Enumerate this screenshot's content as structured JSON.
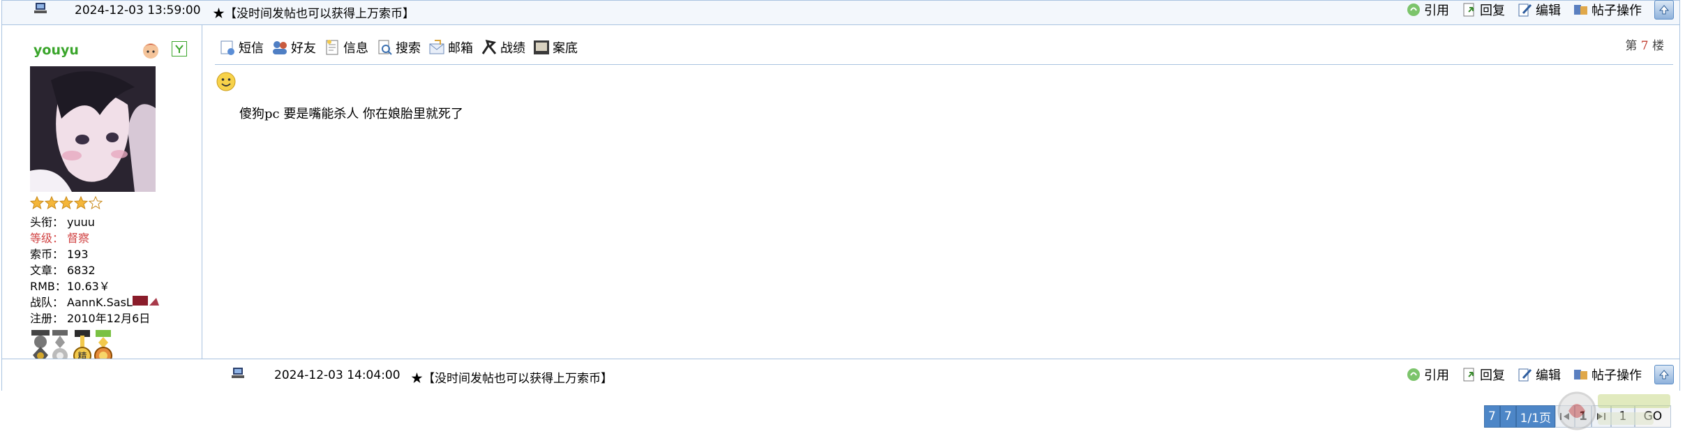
{
  "top_bar": {
    "timestamp": "2024-12-03 13:59:00",
    "signature": "★【没时间发帖也可以获得上万索币】",
    "actions": [
      {
        "label": "引用",
        "icon": "quote-icon"
      },
      {
        "label": "回复",
        "icon": "reply-icon"
      },
      {
        "label": "编辑",
        "icon": "edit-icon"
      },
      {
        "label": "帖子操作",
        "icon": "post-actions-icon"
      }
    ]
  },
  "user": {
    "name": "youyu",
    "rank_stars": 4,
    "rank_stars_max": 5,
    "fields": [
      {
        "label": "头衔：",
        "value": "yuuu",
        "highlight": false
      },
      {
        "label": "等级：",
        "value": "督察",
        "highlight": true
      },
      {
        "label": "索币：",
        "value": "193",
        "highlight": false
      },
      {
        "label": "文章：",
        "value": "6832",
        "highlight": false
      },
      {
        "label": "RMB：",
        "value": "10.63￥",
        "highlight": false
      },
      {
        "label": "战队：",
        "value": "AannK.SasL",
        "highlight": false
      },
      {
        "label": "注册：",
        "value": "2010年12月6日",
        "highlight": false
      }
    ]
  },
  "toolbar": {
    "buttons": [
      {
        "label": "短信",
        "icon": "message-icon"
      },
      {
        "label": "好友",
        "icon": "friends-icon"
      },
      {
        "label": "信息",
        "icon": "info-icon"
      },
      {
        "label": "搜索",
        "icon": "search-icon"
      },
      {
        "label": "邮箱",
        "icon": "mail-icon"
      },
      {
        "label": "战绩",
        "icon": "record-icon"
      },
      {
        "label": "案底",
        "icon": "case-file-icon"
      }
    ]
  },
  "floor": {
    "prefix": "第",
    "number": "7",
    "suffix": "楼"
  },
  "post": {
    "text": "傻狗pc  要是嘴能杀人 你在娘胎里就死了"
  },
  "bottom_bar": {
    "timestamp": "2024-12-03 14:04:00",
    "signature": "★【没时间发帖也可以获得上万索币】",
    "actions": [
      {
        "label": "引用"
      },
      {
        "label": "回复"
      },
      {
        "label": "编辑"
      },
      {
        "label": "帖子操作"
      }
    ]
  },
  "pager": {
    "total_posts": "7",
    "per_page": "7",
    "page_info": "1/1页",
    "current_page": "1",
    "jump_value": "1",
    "go_label": "GO"
  },
  "colors": {
    "border": "#a9c3e0",
    "username": "#3aa52b",
    "highlight_red": "#d14545",
    "pager_blue": "#4d86c7"
  }
}
